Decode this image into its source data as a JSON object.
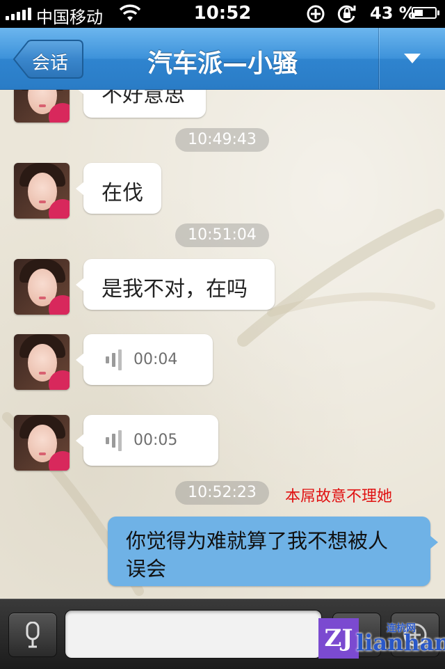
{
  "status_bar": {
    "carrier": "中国移动",
    "time": "10:52",
    "battery": "43 %",
    "battery_level": 0.43
  },
  "nav": {
    "back_label": "会话",
    "title": "汽车派—小骚"
  },
  "messages": {
    "m0": {
      "text": "不好意思"
    },
    "t1": {
      "time": "10:49:43"
    },
    "m1": {
      "text": "在伐"
    },
    "t2": {
      "time": "10:51:04"
    },
    "m2": {
      "text": "是我不对，在吗"
    },
    "v1": {
      "duration": "00:04"
    },
    "v2": {
      "duration": "00:05"
    },
    "t3": {
      "time": "10:52:23"
    },
    "annotation": "本屌故意不理她",
    "m3": {
      "line1": "你觉得为难就算了我不想被人",
      "line2": "误会"
    }
  },
  "input_bar": {
    "value": ""
  },
  "watermark": {
    "logo": "ZJ",
    "text": "lianhang",
    "cn": "连杭网"
  },
  "colors": {
    "nav_blue": "#3d92da",
    "outgoing_bubble": "#6fb2e6",
    "annotation_red": "#e01010"
  }
}
